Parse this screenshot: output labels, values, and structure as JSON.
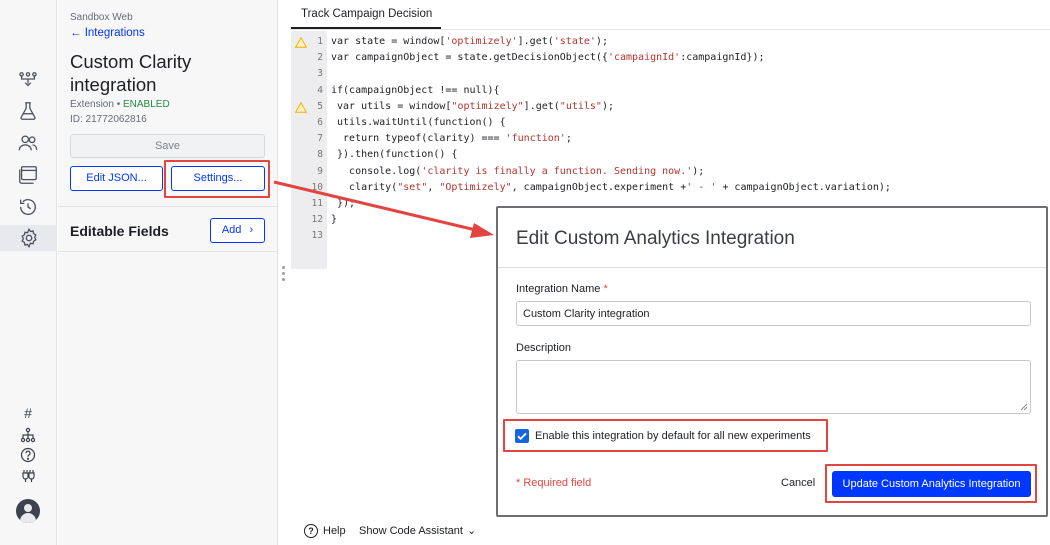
{
  "panel": {
    "crumb": "Sandbox Web",
    "back_label": "← Integrations",
    "title": "Custom Clarity integration",
    "type_label": "Extension • ",
    "status": "ENABLED",
    "id_label": "ID: 21772062816",
    "save_label": "Save",
    "edit_json_label": "Edit JSON...",
    "settings_label": "Settings...",
    "editable_fields_label": "Editable Fields",
    "add_label": "Add"
  },
  "editor": {
    "tab_label": "Track Campaign Decision",
    "line_numbers": [
      "1",
      "2",
      "3",
      "4",
      "5",
      "6",
      "7",
      "8",
      "9",
      "10",
      "11",
      "12",
      "13"
    ],
    "warning_lines": [
      1,
      5
    ],
    "lines": [
      "var state = window['optimizely'].get('state');",
      "var campaignObject = state.getDecisionObject({'campaignId':campaignId});",
      "",
      "if(campaignObject !== null){",
      " var utils = window[\"optimizely\"].get(\"utils\");",
      " utils.waitUntil(function() {",
      "  return typeof(clarity) === 'function';",
      " }).then(function() {",
      "   console.log('clarity is finally a function. Sending now.');",
      "   clarity(\"set\", \"Optimizely\", campaignObject.experiment +' - ' + campaignObject.variation);",
      " });",
      "}",
      ""
    ]
  },
  "footer": {
    "help_label": "Help",
    "code_assistant_label": "Show Code Assistant"
  },
  "modal": {
    "title": "Edit Custom Analytics Integration",
    "name_label": "Integration Name",
    "name_required": "*",
    "name_value": "Custom Clarity integration",
    "description_label": "Description",
    "description_value": "",
    "enable_default_label": "Enable this integration by default for all new experiments",
    "enable_default_checked": true,
    "required_note": "* Required field",
    "cancel_label": "Cancel",
    "update_label": "Update Custom Analytics Integration"
  },
  "colors": {
    "accent": "#0037ff",
    "enabled": "#1f8e3d",
    "highlight": "#e4443f",
    "warning": "#f2b400"
  },
  "icons": {
    "rail": [
      "flows-icon",
      "flask-icon",
      "users-icon",
      "browser-window-icon",
      "history-icon",
      "gear-icon",
      "hash-icon",
      "hierarchy-icon",
      "help-icon",
      "plugs-icon",
      "avatar"
    ]
  }
}
